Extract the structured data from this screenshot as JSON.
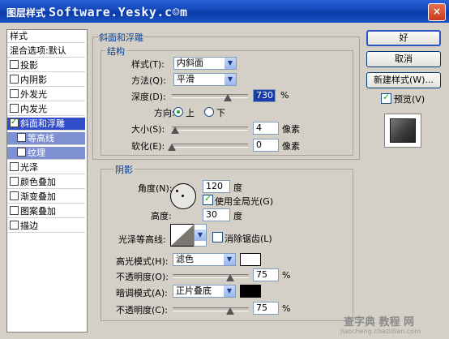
{
  "window": {
    "title": "图层样式",
    "watermark": "Software.Yesky.c☺m",
    "close_glyph": "×"
  },
  "sidebar": {
    "items": [
      {
        "label": "样式",
        "checkbox": false,
        "checked": false
      },
      {
        "label": "混合选项:默认",
        "checkbox": false,
        "checked": false
      },
      {
        "label": "投影",
        "checkbox": true,
        "checked": false
      },
      {
        "label": "内阴影",
        "checkbox": true,
        "checked": false
      },
      {
        "label": "外发光",
        "checkbox": true,
        "checked": false
      },
      {
        "label": "内发光",
        "checkbox": true,
        "checked": false
      },
      {
        "label": "斜面和浮雕",
        "checkbox": true,
        "checked": true,
        "selected": true
      },
      {
        "label": "等高线",
        "checkbox": true,
        "checked": false,
        "sub": true
      },
      {
        "label": "纹理",
        "checkbox": true,
        "checked": false,
        "sub": true
      },
      {
        "label": "光泽",
        "checkbox": true,
        "checked": false
      },
      {
        "label": "颜色叠加",
        "checkbox": true,
        "checked": false
      },
      {
        "label": "渐变叠加",
        "checkbox": true,
        "checked": false
      },
      {
        "label": "图案叠加",
        "checkbox": true,
        "checked": false
      },
      {
        "label": "描边",
        "checkbox": true,
        "checked": false
      }
    ]
  },
  "bevel": {
    "section_title": "斜面和浮雕",
    "structure_title": "结构",
    "style_label": "样式(T):",
    "style_value": "内斜面",
    "technique_label": "方法(Q):",
    "technique_value": "平滑",
    "depth_label": "深度(D):",
    "depth_value": "730",
    "depth_unit": "%",
    "direction_label": "方向:",
    "direction_up": "上",
    "direction_down": "下",
    "size_label": "大小(S):",
    "size_value": "4",
    "size_unit": "像素",
    "soften_label": "软化(E):",
    "soften_value": "0",
    "soften_unit": "像素"
  },
  "shading": {
    "title": "阴影",
    "angle_label": "角度(N):",
    "angle_value": "120",
    "angle_unit": "度",
    "global_light_label": "使用全局光(G)",
    "altitude_label": "高度:",
    "altitude_value": "30",
    "altitude_unit": "度",
    "gloss_contour_label": "光泽等高线:",
    "antialias_label": "消除锯齿(L)",
    "highlight_mode_label": "高光模式(H):",
    "highlight_mode_value": "滤色",
    "highlight_opacity_label": "不透明度(O):",
    "highlight_opacity_value": "75",
    "shadow_mode_label": "暗调模式(A):",
    "shadow_mode_value": "正片叠底",
    "shadow_opacity_label": "不透明度(C):",
    "shadow_opacity_value": "75",
    "percent": "%"
  },
  "buttons": {
    "ok": "好",
    "cancel": "取消",
    "new_style": "新建样式(W)...",
    "preview": "预览(V)"
  },
  "footer_watermark": {
    "line1": "查字典 教程 网",
    "line2": "jiaocheng.chazidian.com"
  },
  "colors": {
    "highlight_color": "#ffffff",
    "shadow_color": "#000000",
    "accent": "#304cc8"
  }
}
